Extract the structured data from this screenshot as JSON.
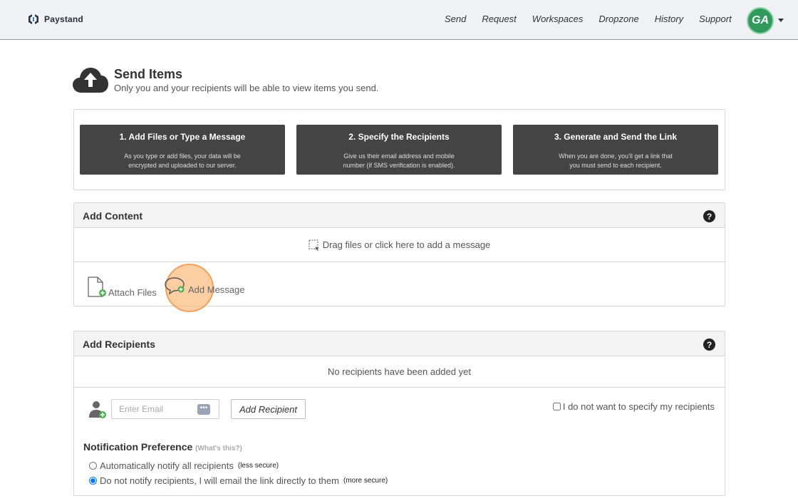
{
  "navbar": {
    "brand": "Paystand",
    "links": [
      "Send",
      "Request",
      "Workspaces",
      "Dropzone",
      "History",
      "Support"
    ],
    "avatar_initials": "GA"
  },
  "header": {
    "title": "Send Items",
    "subtitle": "Only you and your recipients will be able to view items you send."
  },
  "steps": [
    {
      "title": "1. Add Files or Type a Message",
      "desc": "As you type or add files, your data will be encrypted and uploaded to our server."
    },
    {
      "title": "2. Specify the Recipients",
      "desc": "Give us their email address and mobile number (if SMS verification is enabled)."
    },
    {
      "title": "3. Generate and Send the Link",
      "desc": "When you are done, you'll get a link that you must send to each recipient."
    }
  ],
  "content_panel": {
    "title": "Add Content",
    "help": "?",
    "dropzone_text": "Drag files or click here to add a message",
    "attach_files": "Attach Files",
    "add_message": "Add Message"
  },
  "recipients_panel": {
    "title": "Add Recipients",
    "help": "?",
    "empty_text": "No recipients have been added yet",
    "email_placeholder": "Enter Email",
    "dots": "•••",
    "add_button": "Add Recipient",
    "no_specify_label": "I do not want to specify my recipients",
    "notification_title": "Notification Preference",
    "notification_whats_this": "(What's this?)",
    "option_auto": "Automatically notify all recipients",
    "option_auto_note": "(less secure)",
    "option_manual": "Do not notify recipients, I will email the link directly to them",
    "option_manual_note": "(more secure)"
  },
  "colors": {
    "avatar": "#2f9a5c",
    "step_bg": "#444444",
    "highlight": "#f3a05a"
  }
}
